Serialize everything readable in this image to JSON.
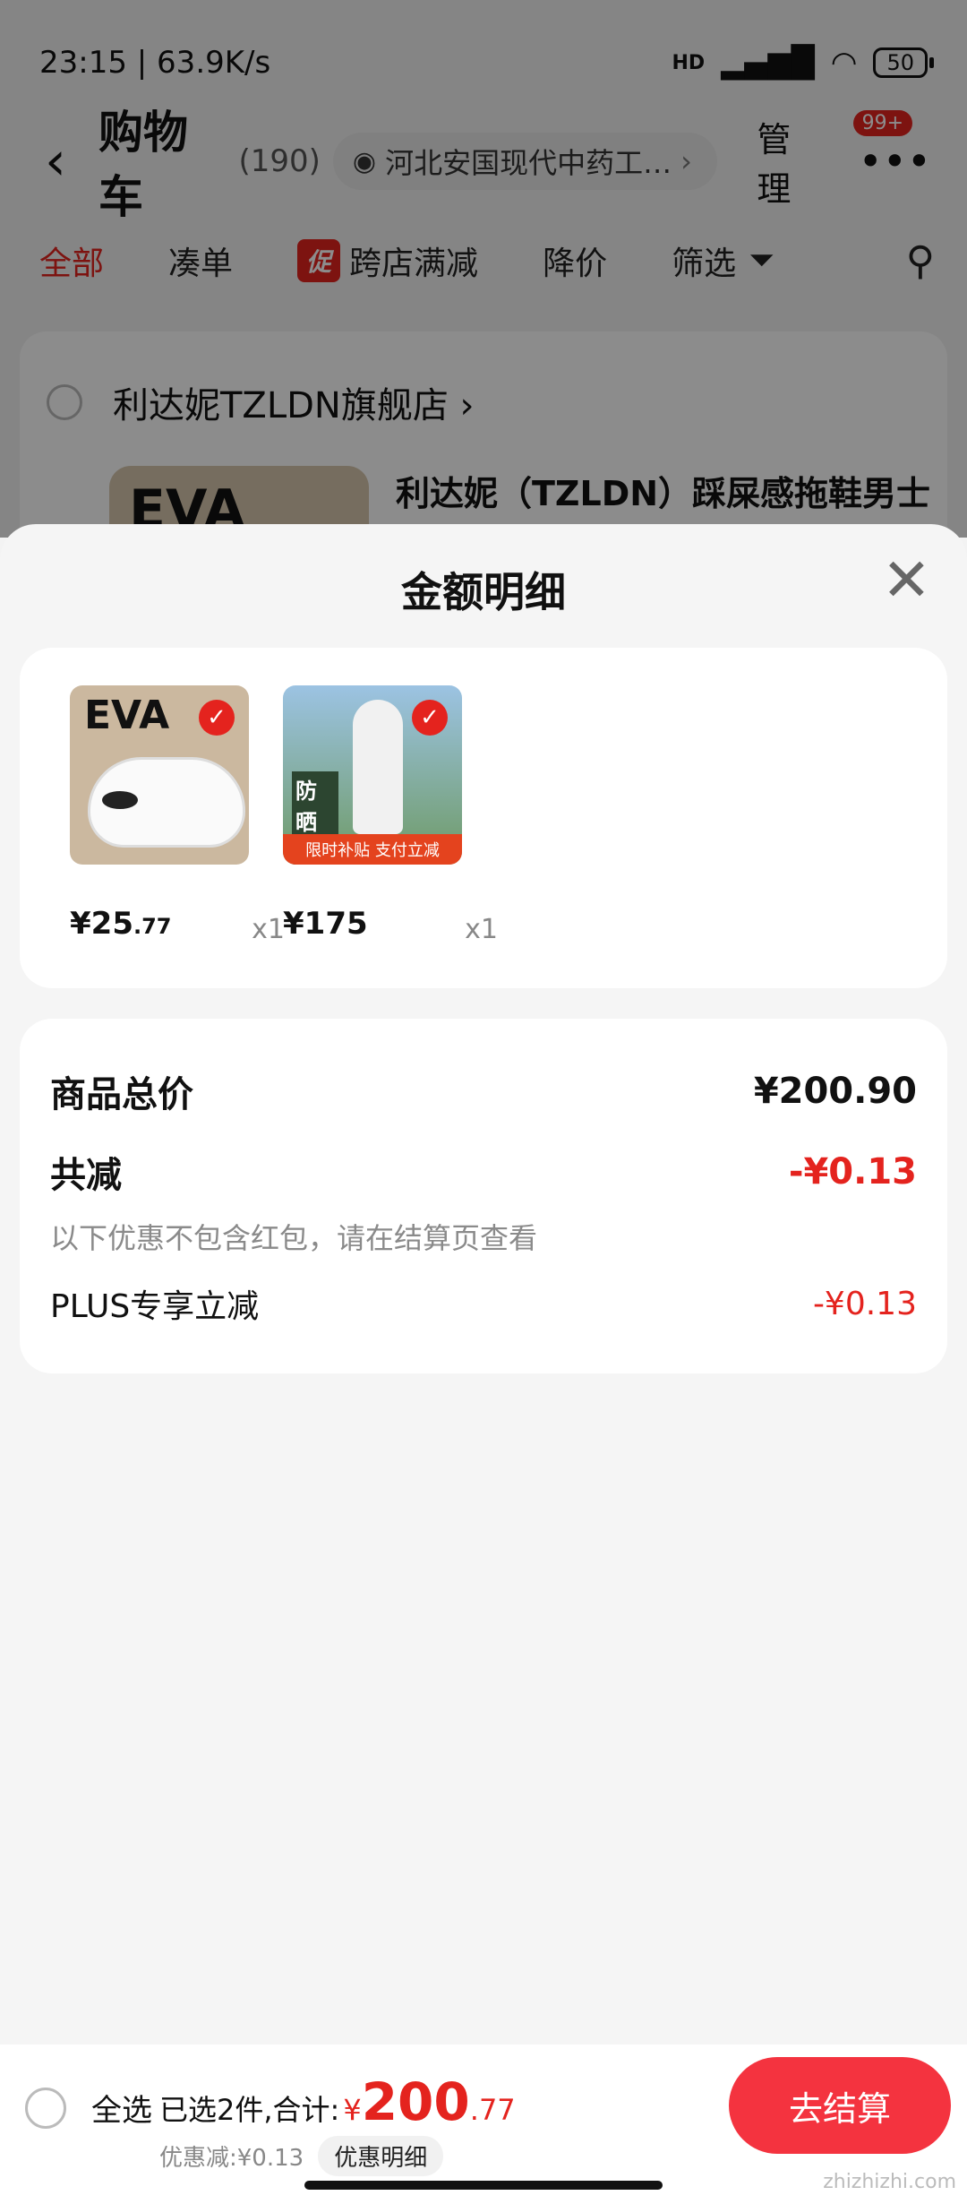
{
  "status_bar": {
    "time_speed": "23:15 | 63.9K/s",
    "battery": "50",
    "network": "HD"
  },
  "nav": {
    "title": "购物车",
    "count": "(190)",
    "location": "河北安国现代中药工…",
    "manage": "管理",
    "badge": "99+"
  },
  "tabs": [
    {
      "label": "全部"
    },
    {
      "label": "凑单"
    },
    {
      "label": "跨店满减",
      "promo": "促"
    },
    {
      "label": "降价"
    },
    {
      "label": "筛选"
    }
  ],
  "store": {
    "name": "利达妮TZLDN旗舰店",
    "product_title": "利达妮（TZLDN）踩屎感拖鞋男士",
    "thumb_text": "EVA"
  },
  "sheet": {
    "title": "金额明细",
    "items": [
      {
        "price_main": "¥25",
        "price_dec": ".77",
        "qty": "x1",
        "badge_text": "EVA",
        "alt": "拖鞋"
      },
      {
        "price_main": "¥175",
        "price_dec": "",
        "qty": "x1",
        "badge_text": "防晒至腿",
        "bar_text": "限时补贴 支付立减",
        "alt": "防晒衣"
      }
    ],
    "summary": {
      "total_label": "商品总价",
      "total_value": "¥200.90",
      "discount_label": "共减",
      "discount_value": "-¥0.13",
      "note": "以下优惠不包含红包，请在结算页查看",
      "plus_label": "PLUS专享立减",
      "plus_value": "-¥0.13"
    }
  },
  "bottom": {
    "select_all": "全选",
    "selected_text": "已选2件,合计:",
    "currency": "¥",
    "amount_main": "200",
    "amount_dec": ".77",
    "discount_text": "优惠减:¥0.13",
    "detail_chip": "优惠明细",
    "checkout": "去结算"
  },
  "watermark": "zhizhizhi.com",
  "colors": {
    "accent": "#e4231e",
    "checkout": "#f4333f"
  }
}
